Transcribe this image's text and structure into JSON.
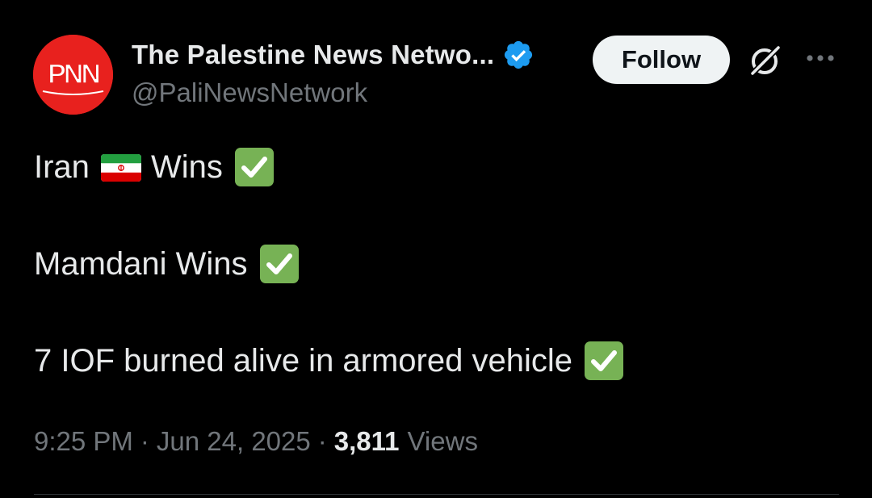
{
  "author": {
    "display_name": "The Palestine News Netwo...",
    "handle": "@PaliNewsNetwork",
    "avatar_text": "PNN",
    "avatar_color": "#e8211e",
    "verified": true,
    "verified_color": "#1d9bf0"
  },
  "actions": {
    "follow_label": "Follow",
    "grok_icon": "grok-icon",
    "more_icon": "more-horizontal-icon"
  },
  "tweet": {
    "lines": [
      {
        "parts": [
          "Iran",
          "Wins"
        ],
        "emoji": [
          "iran-flag",
          "check-mark-button"
        ]
      },
      {
        "text": "Mamdani Wins",
        "emoji": [
          "check-mark-button"
        ]
      },
      {
        "text": "7 IOF burned alive in armored vehicle",
        "emoji": [
          "check-mark-button"
        ]
      }
    ]
  },
  "meta": {
    "time": "9:25 PM",
    "separator": "·",
    "date": "Jun 24, 2025",
    "views_count": "3,811",
    "views_label": "Views"
  },
  "colors": {
    "background": "#000000",
    "primary_text": "#e7e9ea",
    "secondary_text": "#71767b",
    "check_green": "#77b255",
    "follow_bg": "#eff3f4"
  }
}
